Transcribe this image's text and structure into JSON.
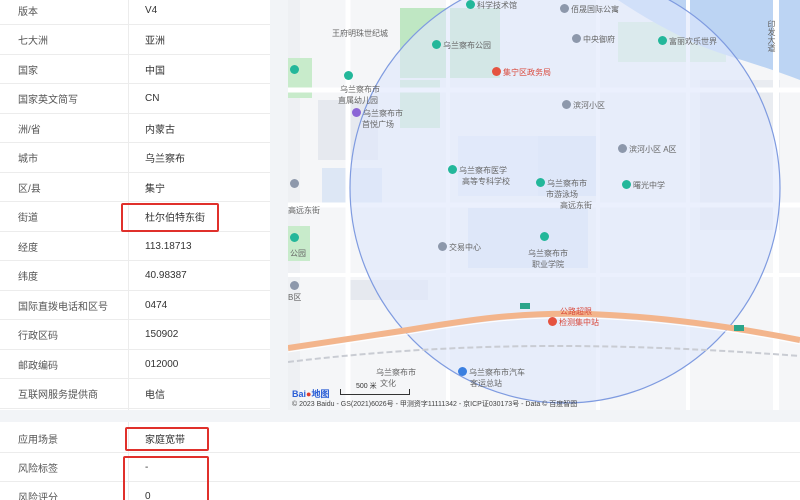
{
  "info_table": [
    {
      "label": "版本",
      "value": "V4"
    },
    {
      "label": "七大洲",
      "value": "亚洲"
    },
    {
      "label": "国家",
      "value": "中国"
    },
    {
      "label": "国家英文简写",
      "value": "CN"
    },
    {
      "label": "洲/省",
      "value": "内蒙古"
    },
    {
      "label": "城市",
      "value": "乌兰察布"
    },
    {
      "label": "区/县",
      "value": "集宁"
    },
    {
      "label": "街道",
      "value": "杜尔伯特东街"
    },
    {
      "label": "经度",
      "value": "113.18713"
    },
    {
      "label": "纬度",
      "value": "40.98387"
    },
    {
      "label": "国际直拨电话和区号",
      "value": "0474"
    },
    {
      "label": "行政区码",
      "value": "150902"
    },
    {
      "label": "邮政编码",
      "value": "012000"
    },
    {
      "label": "互联网服务提供商",
      "value": "电信"
    }
  ],
  "bottom_table": [
    {
      "label": "应用场景",
      "value": "家庭宽带"
    },
    {
      "label": "风险标签",
      "value": "-"
    },
    {
      "label": "风险评分",
      "value": "0"
    }
  ],
  "map": {
    "labels": {
      "school_top": "科学技术馆",
      "wangfu": "王府明珠世纪城",
      "wulanchabu_park": "乌兰察布公园",
      "baiyi_apartment": "佰晟国际公寓",
      "zhongyang_yuan": "中央御府",
      "fuyang_world": "富丽欢乐世界",
      "district_gov": "集宁区政务局",
      "kindergarten_1": "乌兰察布市",
      "kindergarten_2": "直属幼儿园",
      "binhe_xiaoqu": "滨河小区",
      "wanda_1": "乌兰察布市",
      "wanda_2": "首悦广场",
      "binhe_a": "滨河小区 A区",
      "medical_1": "乌兰察布医学",
      "medical_2": "高等专科学校",
      "water_1": "乌兰察布市",
      "water_2": "市游泳场",
      "sunshine_school": "曙光中学",
      "gaoyuan_road_left": "高远东街",
      "gaoyuan_road_right": "高远东街",
      "park_left": "公园",
      "trade_center": "交易中心",
      "vocational_1": "乌兰察布市",
      "vocational_2": "职业学院",
      "b_district": "B区",
      "highway_station_1": "公路超限",
      "highway_station_2": "检测集中站",
      "car_1": "乌兰察布市汽车",
      "car_2": "客运总站",
      "culture_1": "乌兰察布市",
      "culture_2": "文化",
      "qianwa_road": "印发大道"
    },
    "scale": "500 米",
    "logo_text": "Bai",
    "logo_suffix": "地图",
    "copyright": "© 2023 Baidu - GS(2021)6026号 - 甲测资字11111342 - 京ICP证030173号 - Data © 百度智图"
  },
  "colors": {
    "highlight": "#e0302b",
    "circle_fill": "#dfe7fb",
    "circle_stroke": "#7f9be0",
    "road_orange": "#f3b58c",
    "green_area": "#bfe7c3"
  }
}
